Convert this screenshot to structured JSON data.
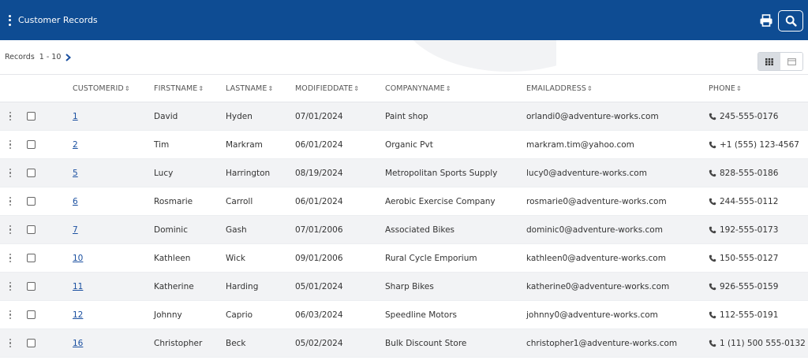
{
  "header": {
    "title": "Customer Records",
    "background": "#0e4c93",
    "icons": {
      "menu": "kebab-icon",
      "print": "print-icon",
      "search": "search-icon"
    }
  },
  "pager": {
    "label": "Records",
    "range": "1 - 10",
    "next_icon": "chevron-right-icon"
  },
  "view_toggle": {
    "options": [
      {
        "icon": "grid-view-icon",
        "active": true
      },
      {
        "icon": "card-view-icon",
        "active": false
      }
    ]
  },
  "table": {
    "columns": [
      {
        "key": "customerid",
        "label": "CUSTOMERID"
      },
      {
        "key": "firstname",
        "label": "FIRSTNAME"
      },
      {
        "key": "lastname",
        "label": "LASTNAME"
      },
      {
        "key": "modifieddate",
        "label": "MODIFIEDDATE"
      },
      {
        "key": "companyname",
        "label": "COMPANYNAME"
      },
      {
        "key": "emailaddress",
        "label": "EMAILADDRESS"
      },
      {
        "key": "phone",
        "label": "PHONE"
      }
    ],
    "rows": [
      {
        "customerid": "1",
        "firstname": "David",
        "lastname": "Hyden",
        "modifieddate": "07/01/2024",
        "companyname": "Paint shop",
        "emailaddress": "orlandi0@adventure-works.com",
        "phone": "245-555-0176"
      },
      {
        "customerid": "2",
        "firstname": "Tim",
        "lastname": "Markram",
        "modifieddate": "06/01/2024",
        "companyname": "Organic Pvt",
        "emailaddress": "markram.tim@yahoo.com",
        "phone": "+1 (555) 123-4567"
      },
      {
        "customerid": "5",
        "firstname": "Lucy",
        "lastname": "Harrington",
        "modifieddate": "08/19/2024",
        "companyname": "Metropolitan Sports Supply",
        "emailaddress": "lucy0@adventure-works.com",
        "phone": "828-555-0186"
      },
      {
        "customerid": "6",
        "firstname": "Rosmarie",
        "lastname": "Carroll",
        "modifieddate": "06/01/2024",
        "companyname": "Aerobic Exercise Company",
        "emailaddress": "rosmarie0@adventure-works.com",
        "phone": "244-555-0112"
      },
      {
        "customerid": "7",
        "firstname": "Dominic",
        "lastname": "Gash",
        "modifieddate": "07/01/2006",
        "companyname": "Associated Bikes",
        "emailaddress": "dominic0@adventure-works.com",
        "phone": "192-555-0173"
      },
      {
        "customerid": "10",
        "firstname": "Kathleen",
        "lastname": "Wick",
        "modifieddate": "09/01/2006",
        "companyname": "Rural Cycle Emporium",
        "emailaddress": "kathleen0@adventure-works.com",
        "phone": "150-555-0127"
      },
      {
        "customerid": "11",
        "firstname": "Katherine",
        "lastname": "Harding",
        "modifieddate": "05/01/2024",
        "companyname": "Sharp Bikes",
        "emailaddress": "katherine0@adventure-works.com",
        "phone": "926-555-0159"
      },
      {
        "customerid": "12",
        "firstname": "Johnny",
        "lastname": "Caprio",
        "modifieddate": "06/03/2024",
        "companyname": "Speedline Motors",
        "emailaddress": "johnny0@adventure-works.com",
        "phone": "112-555-0191"
      },
      {
        "customerid": "16",
        "firstname": "Christopher",
        "lastname": "Beck",
        "modifieddate": "05/02/2024",
        "companyname": "Bulk Discount Store",
        "emailaddress": "christopher1@adventure-works.com",
        "phone": "1 (11) 500 555-0132"
      }
    ]
  }
}
